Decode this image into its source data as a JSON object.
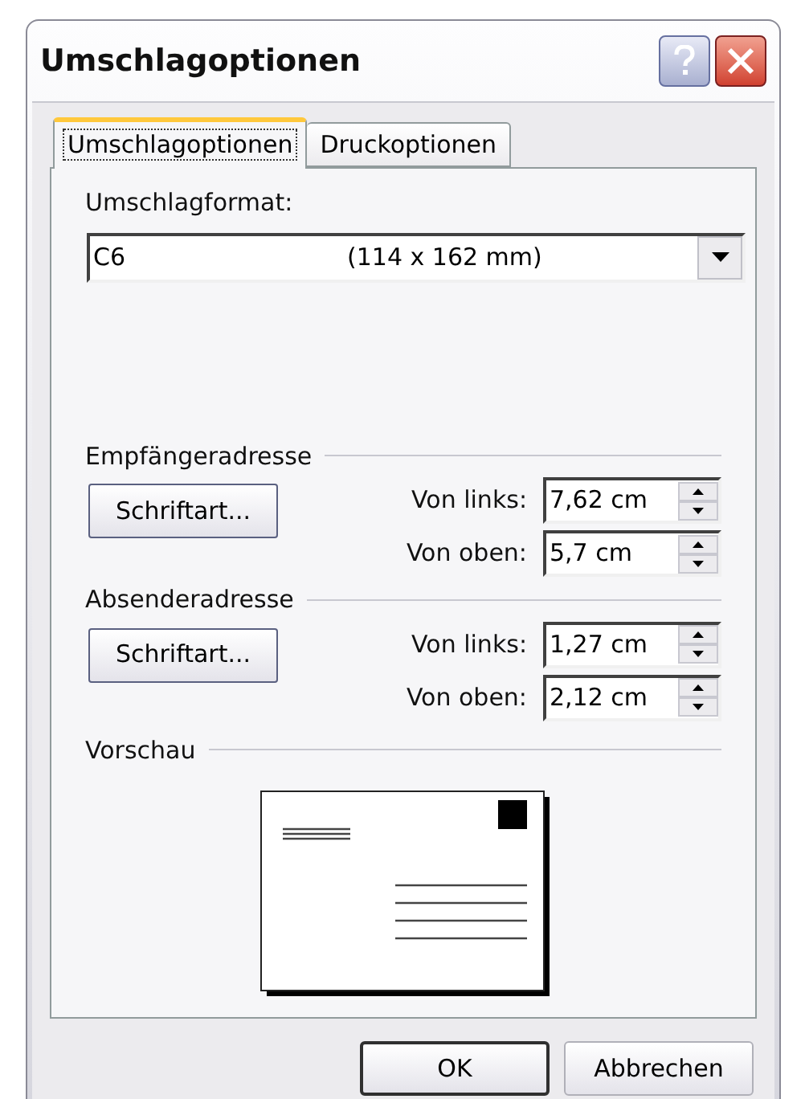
{
  "window": {
    "title": "Umschlagoptionen"
  },
  "tabs": [
    {
      "label": "Umschlagoptionen",
      "selected": true
    },
    {
      "label": "Druckoptionen",
      "selected": false
    }
  ],
  "envelope_size": {
    "label": "Umschlagformat:",
    "value": "C6",
    "value_detail": "(114 x 162 mm)"
  },
  "groups": [
    {
      "title": "Empfängeradresse",
      "font_button": {
        "label": "Schriftart..."
      },
      "fields": [
        {
          "label": "Von links:",
          "value": "7,62 cm"
        },
        {
          "label": "Von oben:",
          "value": "5,7 cm"
        }
      ]
    },
    {
      "title": "Absenderadresse",
      "font_button": {
        "label": "Schriftart..."
      },
      "fields": [
        {
          "label": "Von links:",
          "value": "1,27 cm"
        },
        {
          "label": "Von oben:",
          "value": "2,12 cm"
        }
      ]
    }
  ],
  "preview": {
    "title": "Vorschau"
  },
  "buttons": [
    {
      "label": "OK",
      "kind": "default"
    },
    {
      "label": "Abbrechen",
      "kind": "normal"
    }
  ]
}
